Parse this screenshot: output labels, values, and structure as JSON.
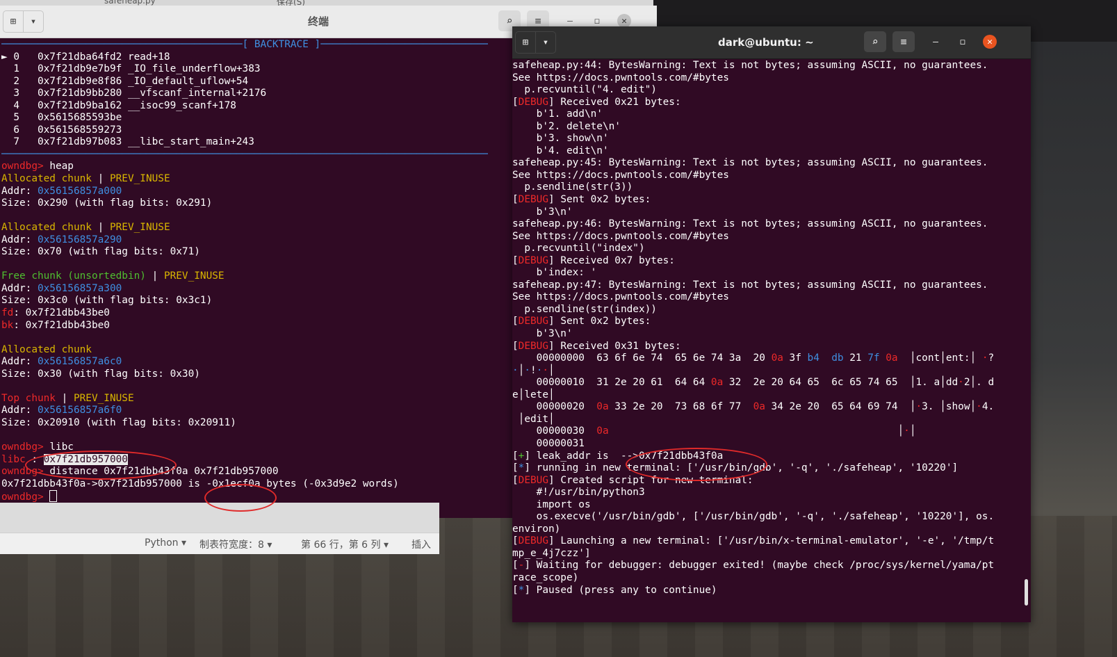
{
  "editor": {
    "filename": "safeheap.py",
    "save_label": "保存(S)",
    "status": {
      "language": "Python",
      "tab_width": "制表符宽度：8",
      "position": "第 66 行，第 6 列",
      "insert": "插入"
    }
  },
  "left_window": {
    "title": "终端",
    "lines": [
      [
        {
          "t": "────────────────────────────────────────",
          "c": "c-blue"
        },
        {
          "t": "[ BACKTRACE ]",
          "c": "c-blue"
        },
        {
          "t": "─────────────────────────────────────────────",
          "c": "c-blue"
        }
      ],
      [
        {
          "t": "► 0   0x7f21dba64fd2 read+18"
        }
      ],
      [
        {
          "t": "  1   0x7f21db9e7b9f _IO_file_underflow+383"
        }
      ],
      [
        {
          "t": "  2   0x7f21db9e8f86 _IO_default_uflow+54"
        }
      ],
      [
        {
          "t": "  3   0x7f21db9bb280 __vfscanf_internal+2176"
        }
      ],
      [
        {
          "t": "  4   0x7f21db9ba162 __isoc99_scanf+178"
        }
      ],
      [
        {
          "t": "  5   0x5615685593be"
        }
      ],
      [
        {
          "t": "  6   0x561568559273"
        }
      ],
      [
        {
          "t": "  7   0x7f21db97b083 __libc_start_main+243"
        }
      ],
      [
        {
          "t": "──────────────────────────────────────────────────────────────────────────────────────────",
          "c": "c-blue"
        }
      ],
      [
        {
          "t": "owndbg> ",
          "c": "c-red"
        },
        {
          "t": "heap"
        }
      ],
      [
        {
          "t": "Allocated chunk",
          "c": "c-yellow"
        },
        {
          "t": " | "
        },
        {
          "t": "PREV_INUSE",
          "c": "c-yellow"
        }
      ],
      [
        {
          "t": "Addr: "
        },
        {
          "t": "0x56156857a000",
          "c": "c-blue"
        }
      ],
      [
        {
          "t": "Size: 0x290 (with flag bits: 0x291)"
        }
      ],
      [
        {
          "t": ""
        }
      ],
      [
        {
          "t": "Allocated chunk",
          "c": "c-yellow"
        },
        {
          "t": " | "
        },
        {
          "t": "PREV_INUSE",
          "c": "c-yellow"
        }
      ],
      [
        {
          "t": "Addr: "
        },
        {
          "t": "0x56156857a290",
          "c": "c-blue"
        }
      ],
      [
        {
          "t": "Size: 0x70 (with flag bits: 0x71)"
        }
      ],
      [
        {
          "t": ""
        }
      ],
      [
        {
          "t": "Free chunk (unsortedbin)",
          "c": "c-green"
        },
        {
          "t": " | "
        },
        {
          "t": "PREV_INUSE",
          "c": "c-yellow"
        }
      ],
      [
        {
          "t": "Addr: "
        },
        {
          "t": "0x56156857a300",
          "c": "c-blue"
        }
      ],
      [
        {
          "t": "Size: 0x3c0 (with flag bits: 0x3c1)"
        }
      ],
      [
        {
          "t": "fd",
          "c": "c-red"
        },
        {
          "t": ": 0x7f21dbb43be0"
        }
      ],
      [
        {
          "t": "bk",
          "c": "c-red"
        },
        {
          "t": ": 0x7f21dbb43be0"
        }
      ],
      [
        {
          "t": ""
        }
      ],
      [
        {
          "t": "Allocated chunk",
          "c": "c-yellow"
        }
      ],
      [
        {
          "t": "Addr: "
        },
        {
          "t": "0x56156857a6c0",
          "c": "c-blue"
        }
      ],
      [
        {
          "t": "Size: 0x30 (with flag bits: 0x30)"
        }
      ],
      [
        {
          "t": ""
        }
      ],
      [
        {
          "t": "Top chunk",
          "c": "c-red"
        },
        {
          "t": " | "
        },
        {
          "t": "PREV_INUSE",
          "c": "c-yellow"
        }
      ],
      [
        {
          "t": "Addr: "
        },
        {
          "t": "0x56156857a6f0",
          "c": "c-blue"
        }
      ],
      [
        {
          "t": "Size: 0x20910 (with flag bits: 0x20911)"
        }
      ],
      [
        {
          "t": ""
        }
      ],
      [
        {
          "t": "owndbg> ",
          "c": "c-red"
        },
        {
          "t": "libc"
        }
      ],
      [
        {
          "t": "libc",
          "c": "c-red"
        },
        {
          "t": " : "
        },
        {
          "t": "0x7f21db957000",
          "c": "c-hlbg"
        }
      ],
      [
        {
          "t": "owndbg> ",
          "c": "c-red"
        },
        {
          "t": "distance 0x7f21dbb43f0a 0x7f21db957000"
        }
      ],
      [
        {
          "t": "0x7f21dbb43f0a->0x7f21db957000 is -0x1ecf0a bytes (-0x3d9e2 words)"
        }
      ],
      [
        {
          "t": "owndbg> ",
          "c": "c-red"
        },
        {
          "t": "",
          "c": "c-cursor"
        }
      ]
    ]
  },
  "right_window": {
    "title": "dark@ubuntu: ~",
    "lines": [
      [
        {
          "t": "safeheap.py:44: BytesWarning: Text is not bytes; assuming ASCII, no guarantees."
        }
      ],
      [
        {
          "t": "See https://docs.pwntools.com/#bytes"
        }
      ],
      [
        {
          "t": "  p.recvuntil(\"4. edit\")"
        }
      ],
      [
        {
          "t": "["
        },
        {
          "t": "DEBUG",
          "c": "c-red"
        },
        {
          "t": "] Received 0x21 bytes:"
        }
      ],
      [
        {
          "t": "    b'1. add\\n'"
        }
      ],
      [
        {
          "t": "    b'2. delete\\n'"
        }
      ],
      [
        {
          "t": "    b'3. show\\n'"
        }
      ],
      [
        {
          "t": "    b'4. edit\\n'"
        }
      ],
      [
        {
          "t": "safeheap.py:45: BytesWarning: Text is not bytes; assuming ASCII, no guarantees."
        }
      ],
      [
        {
          "t": "See https://docs.pwntools.com/#bytes"
        }
      ],
      [
        {
          "t": "  p.sendline(str(3))"
        }
      ],
      [
        {
          "t": "["
        },
        {
          "t": "DEBUG",
          "c": "c-red"
        },
        {
          "t": "] Sent 0x2 bytes:"
        }
      ],
      [
        {
          "t": "    b'3\\n'"
        }
      ],
      [
        {
          "t": "safeheap.py:46: BytesWarning: Text is not bytes; assuming ASCII, no guarantees."
        }
      ],
      [
        {
          "t": "See https://docs.pwntools.com/#bytes"
        }
      ],
      [
        {
          "t": "  p.recvuntil(\"index\")"
        }
      ],
      [
        {
          "t": "["
        },
        {
          "t": "DEBUG",
          "c": "c-red"
        },
        {
          "t": "] Received 0x7 bytes:"
        }
      ],
      [
        {
          "t": "    b'index: '"
        }
      ],
      [
        {
          "t": "safeheap.py:47: BytesWarning: Text is not bytes; assuming ASCII, no guarantees."
        }
      ],
      [
        {
          "t": "See https://docs.pwntools.com/#bytes"
        }
      ],
      [
        {
          "t": "  p.sendline(str(index))"
        }
      ],
      [
        {
          "t": "["
        },
        {
          "t": "DEBUG",
          "c": "c-red"
        },
        {
          "t": "] Sent 0x2 bytes:"
        }
      ],
      [
        {
          "t": "    b'3\\n'"
        }
      ],
      [
        {
          "t": "["
        },
        {
          "t": "DEBUG",
          "c": "c-red"
        },
        {
          "t": "] Received 0x31 bytes:"
        }
      ],
      [
        {
          "t": "    00000000  63 6f 6e 74  65 6e 74 3a  20 "
        },
        {
          "t": "0a",
          "c": "c-red"
        },
        {
          "t": " 3f "
        },
        {
          "t": "b4",
          "c": "c-blue"
        },
        {
          "t": "  "
        },
        {
          "t": "db",
          "c": "c-blue"
        },
        {
          "t": " 21 "
        },
        {
          "t": "7f",
          "c": "c-blue"
        },
        {
          "t": " "
        },
        {
          "t": "0a",
          "c": "c-red"
        },
        {
          "t": "  │cont│ent:│ "
        },
        {
          "t": "·",
          "c": "c-red"
        },
        {
          "t": "?"
        }
      ],
      [
        {
          "t": "·",
          "c": "c-blue"
        },
        {
          "t": "│"
        },
        {
          "t": "·",
          "c": "c-blue"
        },
        {
          "t": "!"
        },
        {
          "t": "·",
          "c": "c-blue"
        },
        {
          "t": "·",
          "c": "c-red"
        },
        {
          "t": "│"
        }
      ],
      [
        {
          "t": "    00000010  31 2e 20 61  64 64 "
        },
        {
          "t": "0a",
          "c": "c-red"
        },
        {
          "t": " 32  2e 20 64 65  6c 65 74 65  │1. a│dd"
        },
        {
          "t": "·",
          "c": "c-red"
        },
        {
          "t": "2│. d"
        }
      ],
      [
        {
          "t": "e│lete│"
        }
      ],
      [
        {
          "t": "    00000020  "
        },
        {
          "t": "0a",
          "c": "c-red"
        },
        {
          "t": " 33 2e 20  73 68 6f 77  "
        },
        {
          "t": "0a",
          "c": "c-red"
        },
        {
          "t": " 34 2e 20  65 64 69 74  │"
        },
        {
          "t": "·",
          "c": "c-red"
        },
        {
          "t": "3. │show│"
        },
        {
          "t": "·",
          "c": "c-red"
        },
        {
          "t": "4."
        }
      ],
      [
        {
          "t": " │edit│"
        }
      ],
      [
        {
          "t": "    00000030  "
        },
        {
          "t": "0a",
          "c": "c-red"
        },
        {
          "t": "                                                │"
        },
        {
          "t": "·",
          "c": "c-red"
        },
        {
          "t": "│"
        }
      ],
      [
        {
          "t": "    00000031"
        }
      ],
      [
        {
          "t": "["
        },
        {
          "t": "+",
          "c": "c-green"
        },
        {
          "t": "] leak_addr is  -->0x7f21dbb43f0a"
        }
      ],
      [
        {
          "t": "["
        },
        {
          "t": "*",
          "c": "c-blue"
        },
        {
          "t": "] running in new terminal: ['/usr/bin/gdb', '-q', './safeheap', '10220']"
        }
      ],
      [
        {
          "t": "["
        },
        {
          "t": "DEBUG",
          "c": "c-red"
        },
        {
          "t": "] Created script for new terminal:"
        }
      ],
      [
        {
          "t": "    #!/usr/bin/python3"
        }
      ],
      [
        {
          "t": "    import os"
        }
      ],
      [
        {
          "t": "    os.execve('/usr/bin/gdb', ['/usr/bin/gdb', '-q', './safeheap', '10220'], os."
        }
      ],
      [
        {
          "t": "environ)"
        }
      ],
      [
        {
          "t": "["
        },
        {
          "t": "DEBUG",
          "c": "c-red"
        },
        {
          "t": "] Launching a new terminal: ['/usr/bin/x-terminal-emulator', '-e', '/tmp/t"
        }
      ],
      [
        {
          "t": "mp_e_4j7czz']"
        }
      ],
      [
        {
          "t": "["
        },
        {
          "t": "-",
          "c": "c-red"
        },
        {
          "t": "] Waiting for debugger: debugger exited! (maybe check /proc/sys/kernel/yama/pt"
        }
      ],
      [
        {
          "t": "race_scope)"
        }
      ],
      [
        {
          "t": "["
        },
        {
          "t": "*",
          "c": "c-blue"
        },
        {
          "t": "] Paused (press any to continue)"
        }
      ]
    ]
  },
  "icons": {
    "new_tab": "new-tab-icon",
    "dropdown": "chevron-down-icon",
    "search": "search-icon",
    "menu": "hamburger-menu-icon",
    "minimize": "minimize-icon",
    "maximize": "maximize-icon",
    "close": "close-icon"
  },
  "colors": {
    "terminal_bg": "#300a24",
    "close_accent": "#e95420",
    "annotation": "#e02a2a"
  }
}
